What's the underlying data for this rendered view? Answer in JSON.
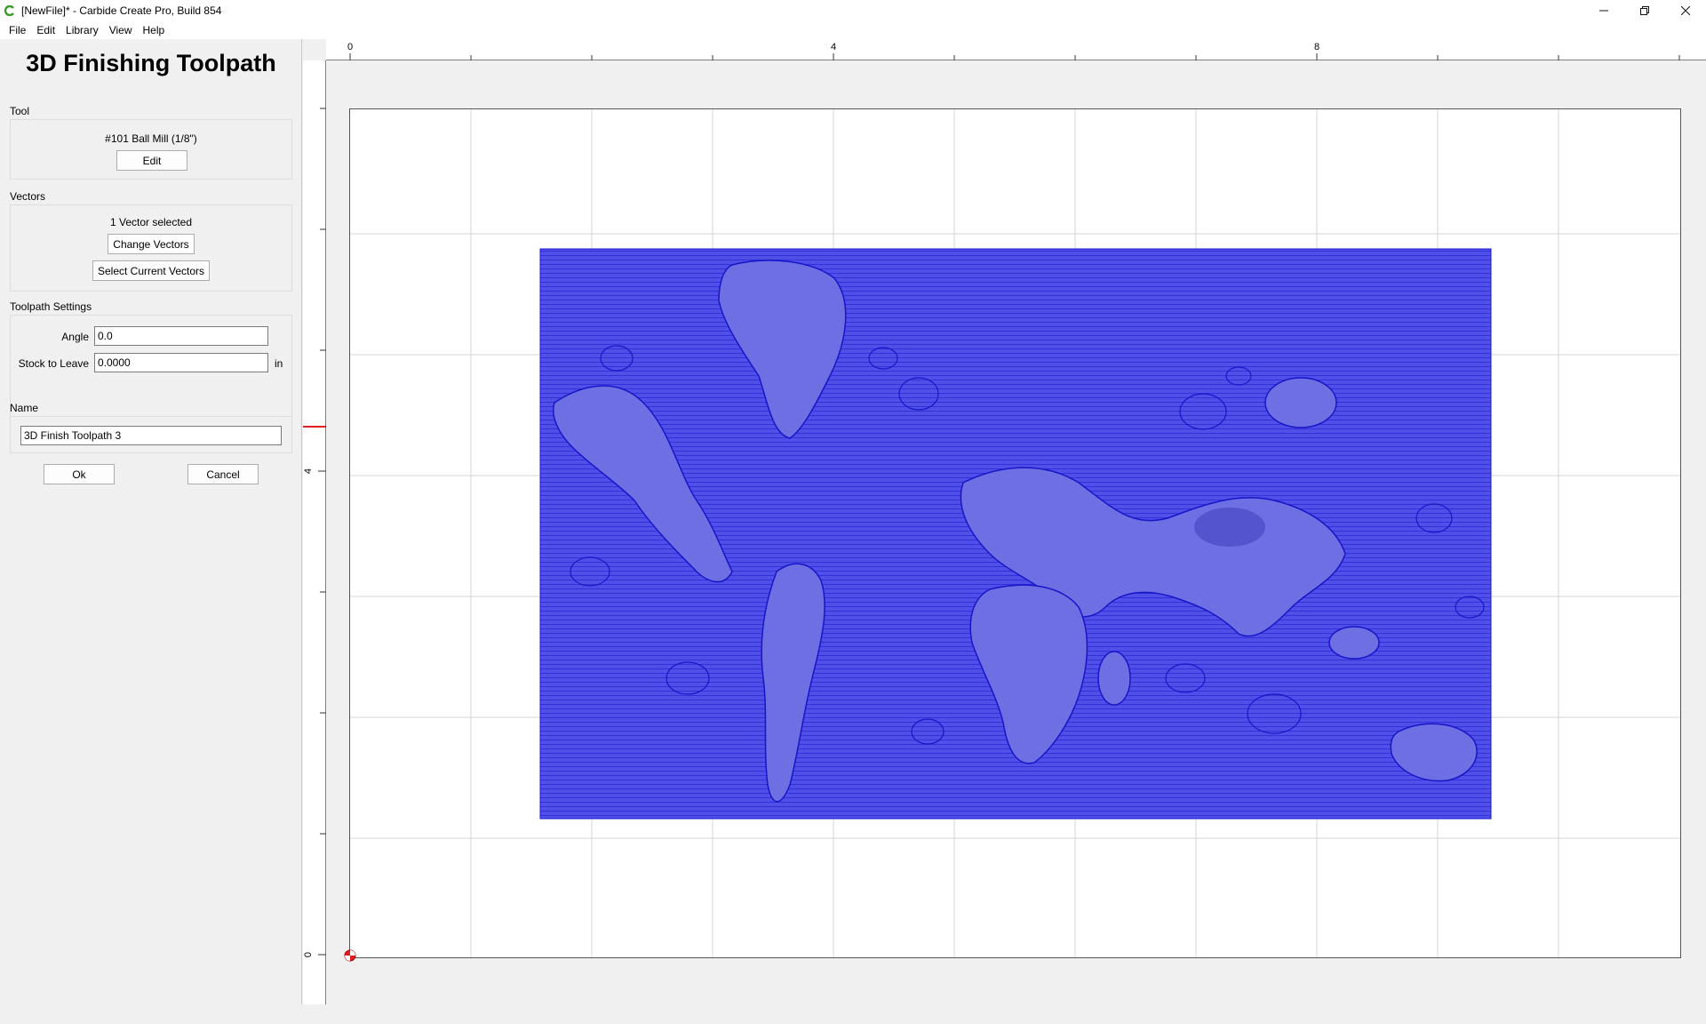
{
  "window": {
    "title": "[NewFile]* - Carbide Create Pro, Build 854",
    "controls": [
      "minimize",
      "restore",
      "close"
    ]
  },
  "menu": [
    "File",
    "Edit",
    "Library",
    "View",
    "Help"
  ],
  "panel": {
    "title": "3D Finishing Toolpath",
    "tool": {
      "section_label": "Tool",
      "tool_name": "#101 Ball Mill (1/8\")",
      "edit_button": "Edit"
    },
    "vectors": {
      "section_label": "Vectors",
      "status": "1 Vector selected",
      "change_button": "Change Vectors",
      "select_button": "Select Current Vectors"
    },
    "settings": {
      "section_label": "Toolpath Settings",
      "angle_label": "Angle",
      "angle_value": "0.0",
      "stock_label": "Stock to Leave",
      "stock_value": "0.0000",
      "stock_unit": "in"
    },
    "name": {
      "section_label": "Name",
      "value": "3D Finish Toolpath 3"
    },
    "ok_button": "Ok",
    "cancel_button": "Cancel"
  },
  "rulers": {
    "horizontal_labels": [
      "0",
      "4",
      "8"
    ],
    "vertical_labels": [
      "4",
      "0"
    ]
  },
  "colors": {
    "toolpath_fill": "#4f4fe6",
    "toolpath_line": "#1a1ad4",
    "grid_line": "#d6d6d6",
    "origin_marker": "#e02020"
  }
}
